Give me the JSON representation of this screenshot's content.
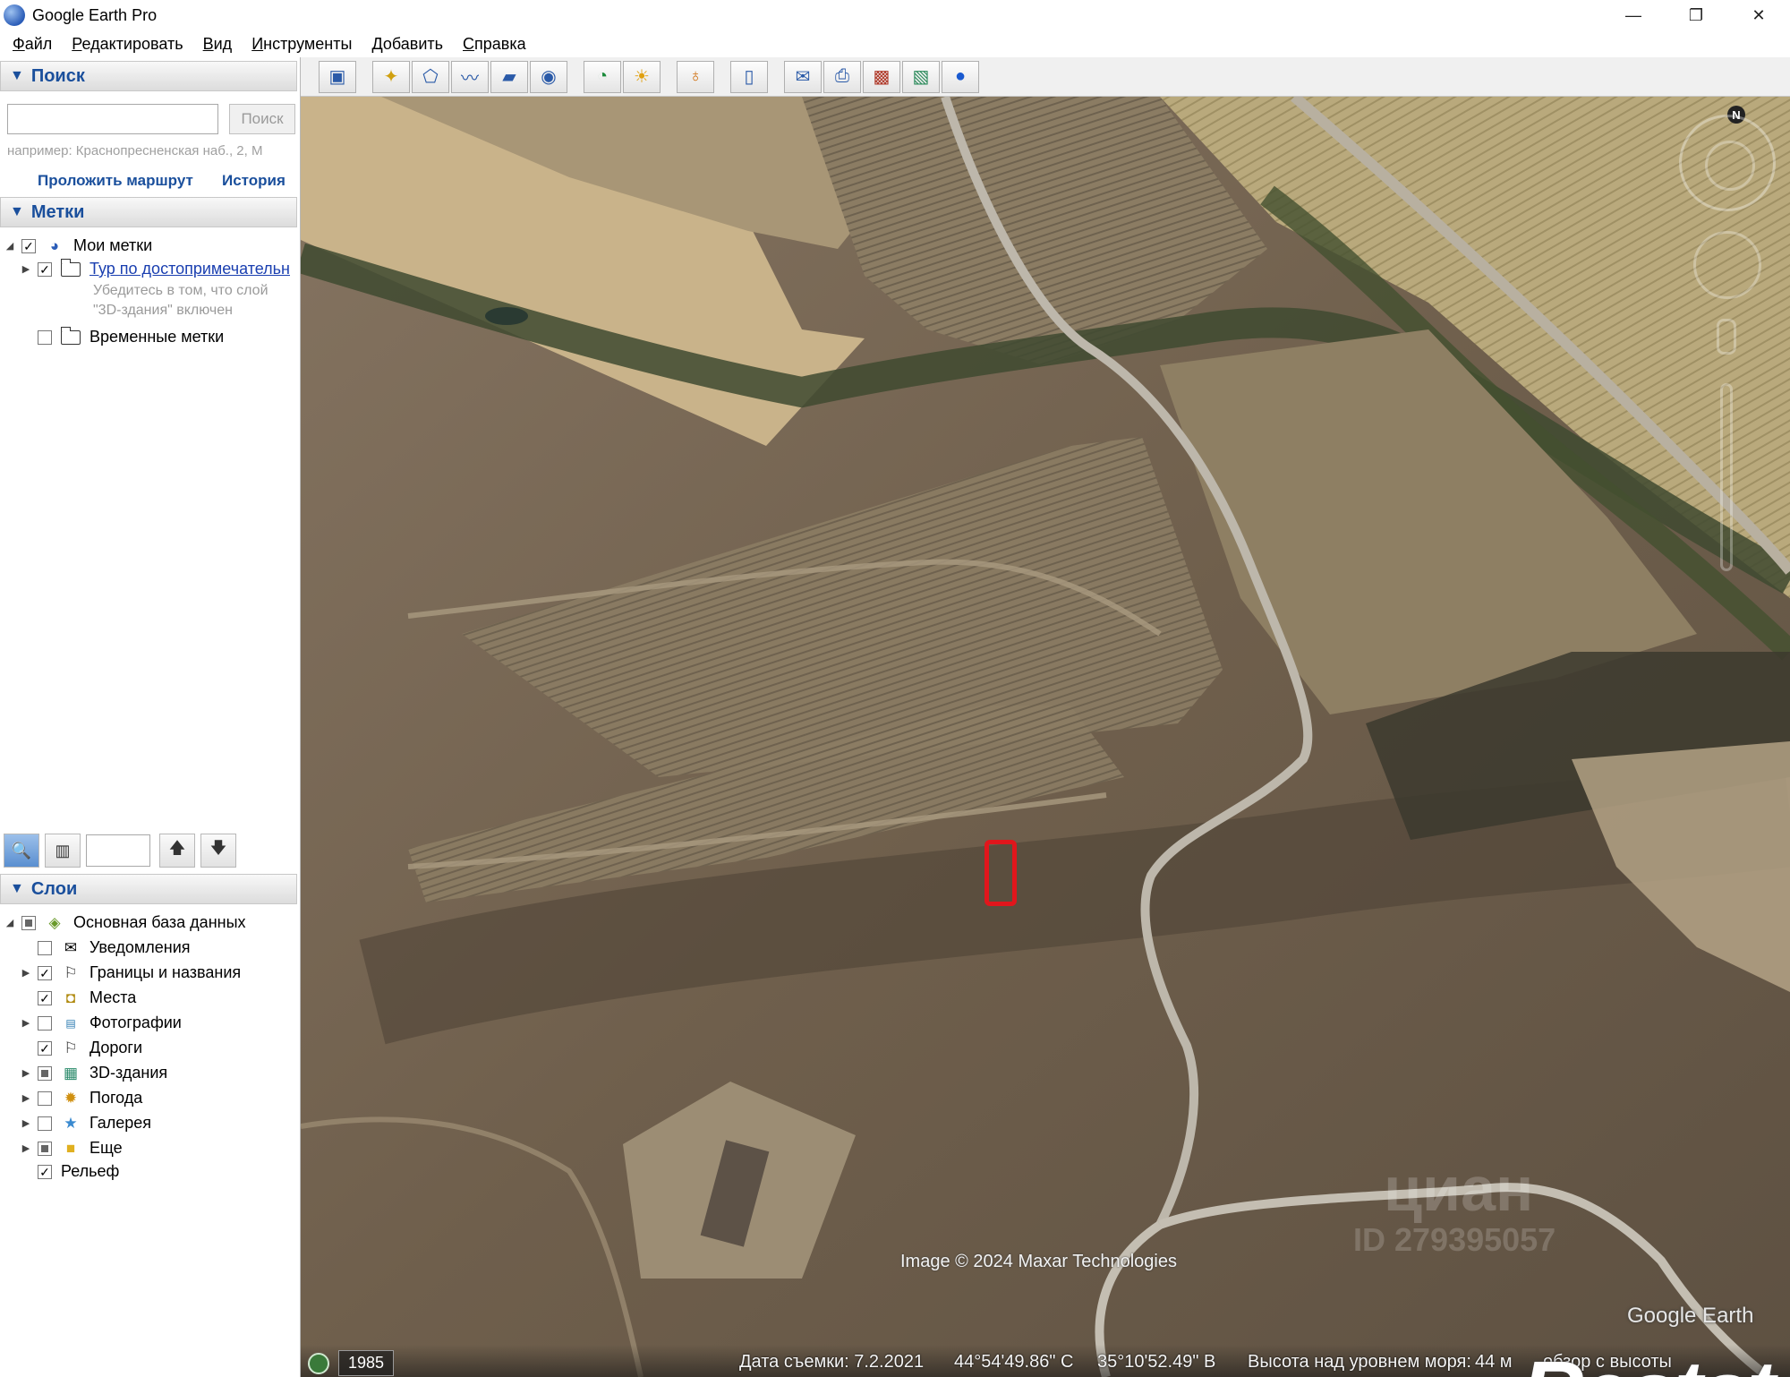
{
  "window": {
    "title": "Google Earth Pro",
    "controls": {
      "minimize": "—",
      "restore": "❐",
      "close": "✕"
    }
  },
  "menu": [
    "Файл",
    "Редактировать",
    "Вид",
    "Инструменты",
    "Добавить",
    "Справка"
  ],
  "search": {
    "header": "Поиск",
    "input_value": "",
    "button": "Поиск",
    "hint": "например: Краснопресненская наб., 2, М",
    "route_link": "Проложить маршрут",
    "history_link": "История"
  },
  "places": {
    "header": "Метки",
    "items": [
      {
        "label": "Мои метки",
        "checked": true,
        "icon": "globe-icon"
      },
      {
        "label": "Тур по достопримечательн",
        "checked": true,
        "icon": "folder-icon"
      },
      {
        "label": "Временные метки",
        "checked": false,
        "icon": "folder-icon"
      }
    ],
    "note_line1": "Убедитесь в том, что слой",
    "note_line2": "\"3D-здания\" включен"
  },
  "layers": {
    "header": "Слои",
    "items": [
      {
        "label": "Основная база данных",
        "state": "mixed",
        "icon": "layers-icon"
      },
      {
        "label": "Уведомления",
        "state": "off",
        "icon": "envelope-icon"
      },
      {
        "label": "Границы и названия",
        "state": "on",
        "icon": "flag-icon"
      },
      {
        "label": "Места",
        "state": "on",
        "icon": "place-icon"
      },
      {
        "label": "Фотографии",
        "state": "off",
        "icon": "photo-icon"
      },
      {
        "label": "Дороги",
        "state": "on",
        "icon": "road-icon"
      },
      {
        "label": "3D-здания",
        "state": "mixed",
        "icon": "building-icon"
      },
      {
        "label": "Погода",
        "state": "off",
        "icon": "sun-icon"
      },
      {
        "label": "Галерея",
        "state": "off",
        "icon": "star-icon"
      },
      {
        "label": "Еще",
        "state": "mixed",
        "icon": "note-icon"
      },
      {
        "label": "Рельеф",
        "state": "on",
        "icon": ""
      }
    ]
  },
  "toolbar_icons": [
    "sidebar-icon",
    "placemark-icon",
    "polygon-icon",
    "path-icon",
    "overlay-icon",
    "tour-icon",
    "history-icon",
    "sun-icon",
    "planets-icon",
    "ruler-icon",
    "email-icon",
    "print-icon",
    "save-image-icon",
    "maps-icon",
    "earth-icon"
  ],
  "map": {
    "attribution": "Image © 2024 Maxar Technologies",
    "brand": "Google Earth",
    "watermark_cian": "циан",
    "watermark_id": "ID 279395057",
    "watermark_restate": "Restate",
    "year": "1985",
    "status": {
      "date": "Дата съемки: 7.2.2021",
      "lat": "44°54'49.86\" С",
      "lon": "35°10'52.49\" В",
      "elevation_label": "Высота над уровнем моря:",
      "elevation_value": "44 м",
      "eye": "обзор с высоты"
    },
    "compass": "N",
    "colors": {
      "marker": "#e1161c",
      "terrain": "#7a6a55",
      "fields": "#c8b58a",
      "road": "#b8b4ac"
    }
  }
}
